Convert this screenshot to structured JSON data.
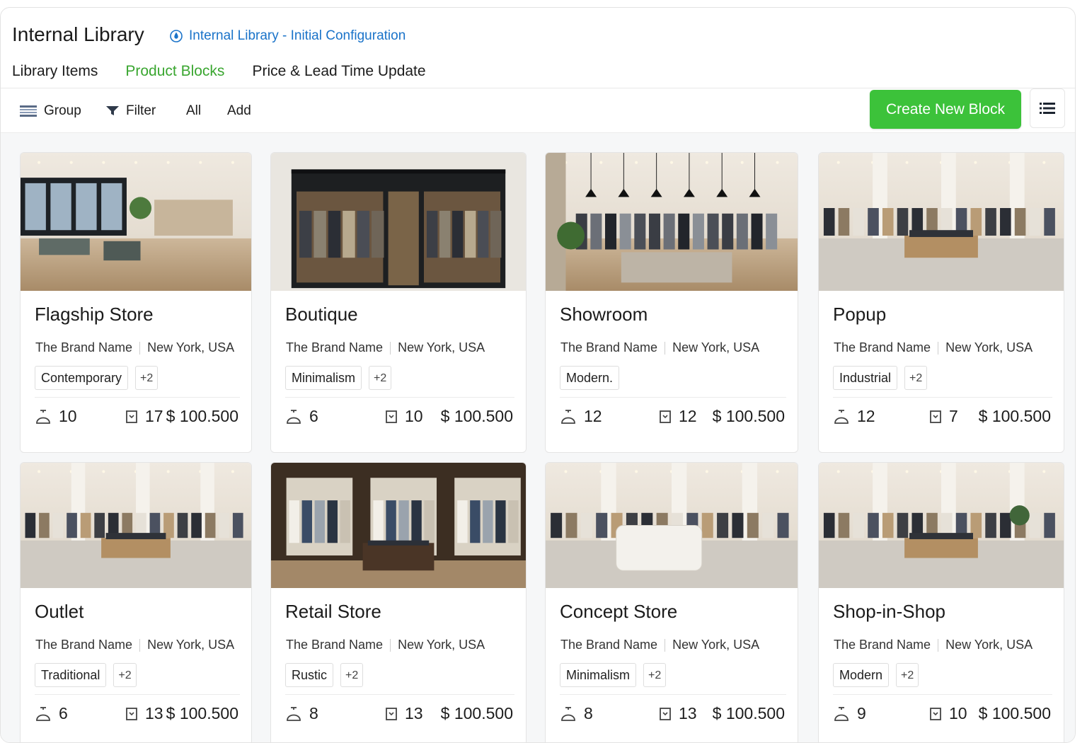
{
  "header": {
    "title": "Internal Library",
    "breadcrumb": "Internal Library - Initial Configuration"
  },
  "tabs": [
    {
      "label": "Library Items",
      "active": false
    },
    {
      "label": "Product Blocks",
      "active": true
    },
    {
      "label": "Price & Lead Time Update",
      "active": false
    }
  ],
  "toolbar": {
    "group": "Group",
    "filter": "Filter",
    "all": "All",
    "add": "Add",
    "create": "Create New Block"
  },
  "colors": {
    "accent": "#3cc23a",
    "active_tab": "#3aa630",
    "link": "#1a73c9"
  },
  "cards": [
    {
      "name": "Flagship Store",
      "brand": "The Brand Name",
      "location": "New York, USA",
      "tag": "Contemporary",
      "more": "+2",
      "count_a": "10",
      "count_b": "17",
      "price": "$ 100.500",
      "scene": "lounge"
    },
    {
      "name": "Boutique",
      "brand": "The Brand Name",
      "location": "New York, USA",
      "tag": "Minimalism",
      "more": "+2",
      "count_a": "6",
      "count_b": "10",
      "price": "$ 100.500",
      "scene": "storefront"
    },
    {
      "name": "Showroom",
      "brand": "The Brand Name",
      "location": "New York, USA",
      "tag": "Modern.",
      "more": "",
      "count_a": "12",
      "count_b": "12",
      "price": "$ 100.500",
      "scene": "showroom"
    },
    {
      "name": "Popup",
      "brand": "The Brand Name",
      "location": "New York, USA",
      "tag": "Industrial",
      "more": "+2",
      "count_a": "12",
      "count_b": "7",
      "price": "$ 100.500",
      "scene": "hall"
    },
    {
      "name": "Outlet",
      "brand": "The Brand Name",
      "location": "New York, USA",
      "tag": "Traditional",
      "more": "+2",
      "count_a": "6",
      "count_b": "13",
      "price": "$ 100.500",
      "scene": "hall"
    },
    {
      "name": "Retail Store",
      "brand": "The Brand Name",
      "location": "New York, USA",
      "tag": "Rustic",
      "more": "+2",
      "count_a": "8",
      "count_b": "13",
      "price": "$ 100.500",
      "scene": "wood"
    },
    {
      "name": "Concept Store",
      "brand": "The Brand Name",
      "location": "New York, USA",
      "tag": "Minimalism",
      "more": "+2",
      "count_a": "8",
      "count_b": "13",
      "price": "$ 100.500",
      "scene": "concept"
    },
    {
      "name": "Shop-in-Shop",
      "brand": "The Brand Name",
      "location": "New York, USA",
      "tag": "Modern",
      "more": "+2",
      "count_a": "9",
      "count_b": "10",
      "price": "$ 100.500",
      "scene": "corridor"
    }
  ]
}
